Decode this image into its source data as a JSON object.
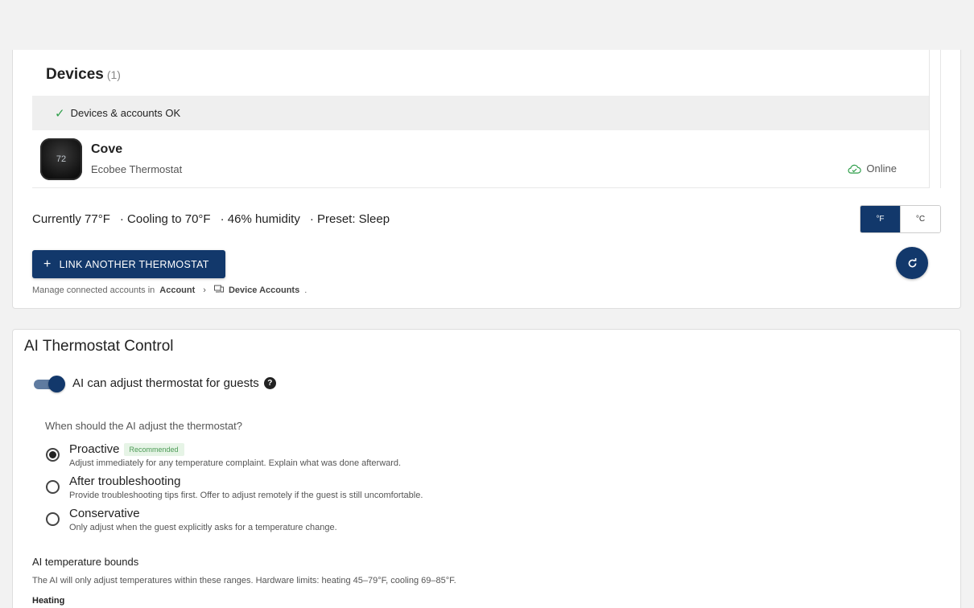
{
  "devices": {
    "title": "Devices",
    "count": "(1)",
    "status_banner": "Devices & accounts OK",
    "items": [
      {
        "name": "Cove",
        "type": "Ecobee Thermostat",
        "status": "Online",
        "display_temp": "72"
      }
    ],
    "stats": {
      "current": "Currently 77°F",
      "target": "· Cooling to 70°F",
      "humidity": "· 46% humidity",
      "preset": "· Preset: Sleep"
    },
    "units": {
      "f_label": "°F",
      "c_label": "°C",
      "selected": "°F"
    },
    "link_button": "LINK ANOTHER THERMOSTAT",
    "manage": {
      "prefix": "Manage connected accounts in",
      "crumb1": "Account",
      "crumb2": "Device Accounts",
      "suffix": "."
    }
  },
  "ai": {
    "title": "AI Thermostat Control",
    "toggle_label": "AI can adjust thermostat for guests",
    "toggle_on": true,
    "question": "When should the AI adjust the thermostat?",
    "options": [
      {
        "label": "Proactive",
        "badge": "Recommended",
        "desc": "Adjust immediately for any temperature complaint. Explain what was done afterward.",
        "checked": true
      },
      {
        "label": "After troubleshooting",
        "desc": "Provide troubleshooting tips first. Offer to adjust remotely if the guest is still uncomfortable.",
        "checked": false
      },
      {
        "label": "Conservative",
        "desc": "Only adjust when the guest explicitly asks for a temperature change.",
        "checked": false
      }
    ],
    "bounds_title": "AI temperature bounds",
    "bounds_desc": "The AI will only adjust temperatures within these ranges. Hardware limits: heating 45–79°F, cooling 69–85°F.",
    "heating_label": "Heating"
  },
  "colors": {
    "primary": "#12386b",
    "ok": "#2e9e4a",
    "badge_bg": "#e6f4e6",
    "badge_text": "#4b9a55"
  }
}
